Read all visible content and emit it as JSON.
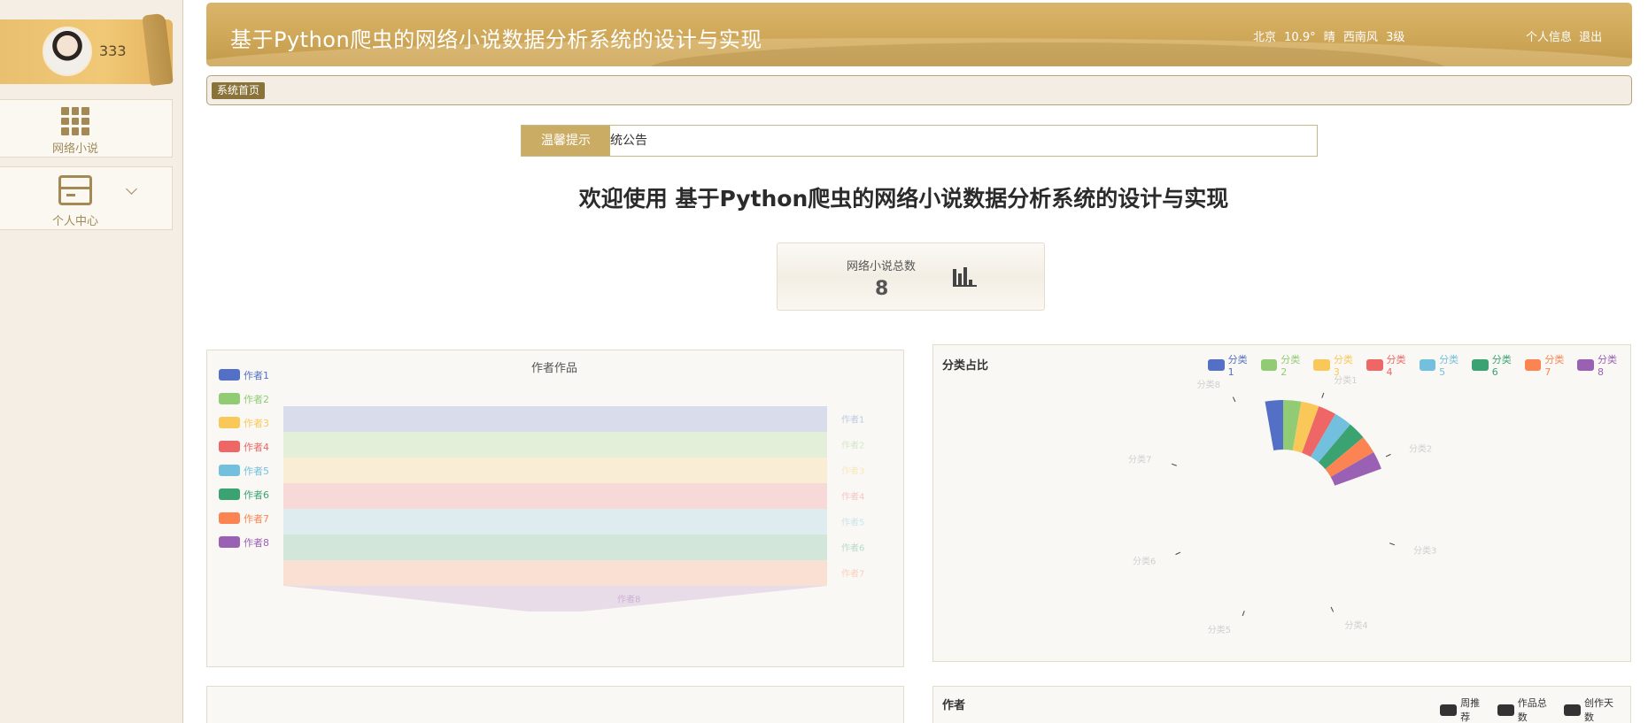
{
  "sidebar": {
    "username": "333",
    "items": [
      {
        "label": "网络小说",
        "icon": "grid-icon"
      },
      {
        "label": "个人中心",
        "icon": "card-icon"
      }
    ]
  },
  "header": {
    "title": "基于Python爬虫的网络小说数据分析系统的设计与实现",
    "weather": {
      "city": "北京",
      "temp": "10.9°",
      "condition": "晴",
      "wind": "西南风",
      "level": "3级"
    },
    "links": [
      "个人信息",
      "退出"
    ]
  },
  "breadcrumb": {
    "home": "系统首页"
  },
  "notice": {
    "label": "温馨提示",
    "text": "统公告"
  },
  "welcome": "欢迎使用 基于Python爬虫的网络小说数据分析系统的设计与实现",
  "stat": {
    "label": "网络小说总数",
    "value": "8"
  },
  "colors": [
    "#5470c6",
    "#91cc75",
    "#fac858",
    "#ee6666",
    "#73c0de",
    "#3ba272",
    "#fc8452",
    "#9a60b4"
  ],
  "panels": {
    "author_works": {
      "title": "作者作品",
      "legend": [
        "作者1",
        "作者2",
        "作者3",
        "作者4",
        "作者5",
        "作者6",
        "作者7",
        "作者8"
      ],
      "funnel_labels": [
        "作者1",
        "作者2",
        "作者3",
        "作者4",
        "作者5",
        "作者6",
        "作者7",
        "作者8"
      ]
    },
    "category": {
      "title": "分类占比",
      "legend": [
        "分类1",
        "分类2",
        "分类3",
        "分类4",
        "分类5",
        "分类6",
        "分类7",
        "分类8"
      ],
      "ring_labels": [
        "分类1",
        "分类2",
        "分类3",
        "分类4",
        "分类5",
        "分类6",
        "分类7",
        "分类8"
      ]
    },
    "author": {
      "title": "作者",
      "legend": [
        "周推荐",
        "作品总数",
        "创作天数"
      ]
    }
  }
}
